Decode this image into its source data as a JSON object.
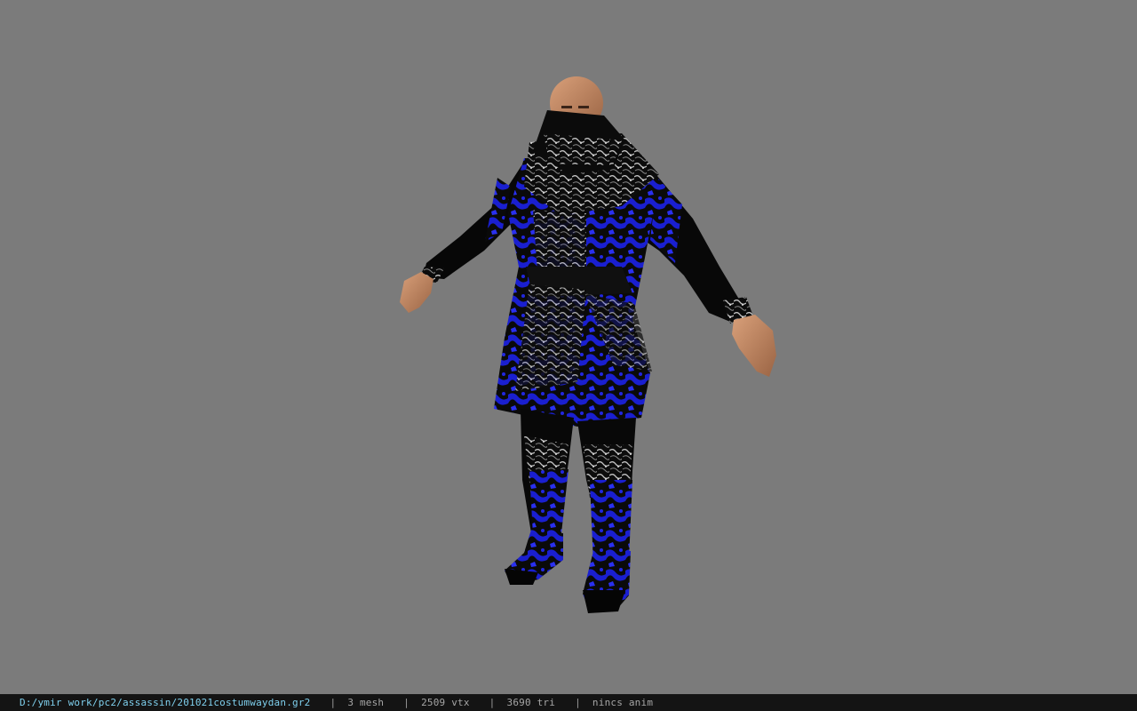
{
  "viewport": {
    "background_color": "#7b7b7b",
    "model_colors": {
      "skin": "#c98c63",
      "skin_shadow": "#9a6444",
      "cloth_black": "#090909",
      "cloth_blue": "#1a1fd0",
      "ornament_silver": "#bdbdbd"
    }
  },
  "status_bar": {
    "file_path": "D:/ymir work/pc2/assassin/201021costumwaydan.gr2",
    "separator": "|",
    "mesh_count": "3 mesh",
    "vertex_count": "2509 vtx",
    "triangle_count": "3690 tri",
    "anim_status": "nincs anim",
    "path_color": "#7fd0ee",
    "text_color": "#a6a6a6"
  }
}
